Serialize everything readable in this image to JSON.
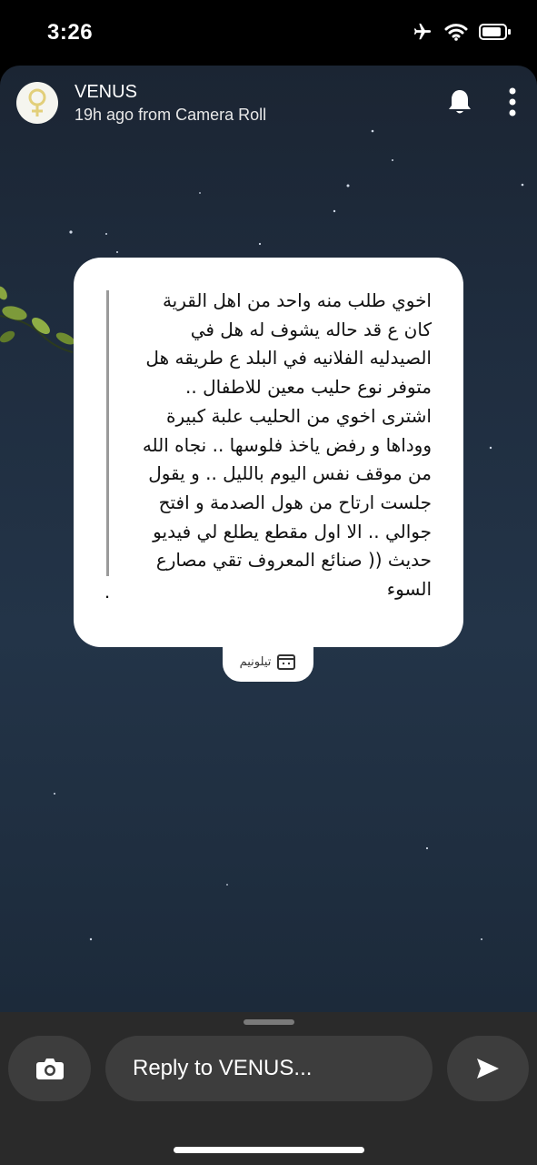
{
  "status_bar": {
    "time": "3:26",
    "icons": [
      "airplane-icon",
      "wifi-icon",
      "battery-icon"
    ]
  },
  "story": {
    "header": {
      "avatar_icon": "venus-symbol-icon",
      "username": "VENUS",
      "subtitle": "19h ago from Camera Roll",
      "actions": [
        "bell-icon",
        "more-vertical-icon"
      ]
    },
    "card": {
      "text": "اخوي طلب منه واحد من اهل القرية\nكان ع قد حاله يشوف له هل في\nالصيدليه الفلانيه في البلد ع طريقه هل\nمتوفر نوع حليب معين للاطفال ..\nاشترى اخوي من الحليب علبة كبيرة\nووداها و رفض ياخذ فلوسها .. نجاه الله\nمن موقف نفس اليوم بالليل .. و يقول\nجلست ارتاح من هول الصدمة و افتح\nجوالي .. الا اول مقطع يطلع لي فيديو\nحديث (( صنائع المعروف تقي مصارع\nالسوء",
      "trailing_dot": "."
    },
    "sticker_tab": {
      "label": "تيلونيم",
      "icon": "telonym-box-icon"
    }
  },
  "bottom_bar": {
    "camera_icon": "camera-icon",
    "reply_placeholder": "Reply to VENUS...",
    "send_icon": "send-arrow-icon"
  },
  "colors": {
    "sky_top": "#1b2533",
    "sky_bottom": "#233448",
    "card": "#ffffff",
    "bottom_bar": "#2a2a2a",
    "field": "#3d3d3d"
  }
}
